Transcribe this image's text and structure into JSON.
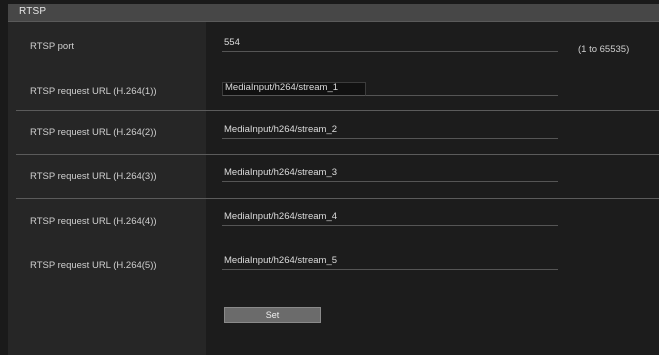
{
  "section": {
    "title": "RTSP"
  },
  "rows": [
    {
      "label": "RTSP port",
      "value": "554",
      "hint": "(1 to 65535)"
    },
    {
      "label": "RTSP request URL (H.264(1))",
      "value": "MediaInput/h264/stream_1"
    },
    {
      "label": "RTSP request URL (H.264(2))",
      "value": "MediaInput/h264/stream_2"
    },
    {
      "label": "RTSP request URL (H.264(3))",
      "value": "MediaInput/h264/stream_3"
    },
    {
      "label": "RTSP request URL (H.264(4))",
      "value": "MediaInput/h264/stream_4"
    },
    {
      "label": "RTSP request URL (H.264(5))",
      "value": "MediaInput/h264/stream_5"
    }
  ],
  "actions": {
    "set_label": "Set"
  }
}
